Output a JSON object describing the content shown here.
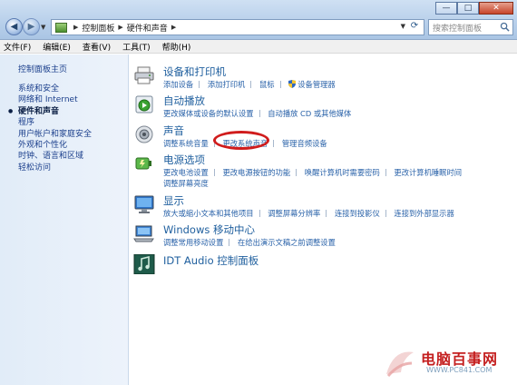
{
  "window": {
    "controls": {
      "minimize": "—",
      "maximize": "□",
      "close": "✕"
    }
  },
  "address": {
    "crumbs": [
      "控制面板",
      "硬件和声音"
    ]
  },
  "search": {
    "placeholder": "搜索控制面板"
  },
  "menu": [
    "文件(F)",
    "编辑(E)",
    "查看(V)",
    "工具(T)",
    "帮助(H)"
  ],
  "sidebar": {
    "home": "控制面板主页",
    "items": [
      {
        "label": "系统和安全",
        "active": false
      },
      {
        "label": "网络和 Internet",
        "active": false
      },
      {
        "label": "硬件和声音",
        "active": true
      },
      {
        "label": "程序",
        "active": false
      },
      {
        "label": "用户帐户和家庭安全",
        "active": false
      },
      {
        "label": "外观和个性化",
        "active": false
      },
      {
        "label": "时钟、语言和区域",
        "active": false
      },
      {
        "label": "轻松访问",
        "active": false
      }
    ]
  },
  "categories": [
    {
      "icon": "printer-icon",
      "title": "设备和打印机",
      "rows": [
        [
          "添加设备",
          "添加打印机",
          "鼠标",
          "设备管理器"
        ]
      ]
    },
    {
      "icon": "autoplay-icon",
      "title": "自动播放",
      "rows": [
        [
          "更改媒体或设备的默认设置",
          "自动播放 CD 或其他媒体"
        ]
      ]
    },
    {
      "icon": "speaker-icon",
      "title": "声音",
      "rows": [
        [
          "调整系统音量",
          "更改系统声音",
          "管理音频设备"
        ]
      ]
    },
    {
      "icon": "power-icon",
      "title": "电源选项",
      "rows": [
        [
          "更改电池设置",
          "更改电源按钮的功能",
          "唤醒计算机时需要密码",
          "更改计算机睡眠时间"
        ],
        [
          "调整屏幕亮度"
        ]
      ]
    },
    {
      "icon": "display-icon",
      "title": "显示",
      "rows": [
        [
          "放大或缩小文本和其他项目",
          "调整屏幕分辨率",
          "连接到投影仪",
          "连接到外部显示器"
        ]
      ]
    },
    {
      "icon": "mobility-center-icon",
      "title": "Windows 移动中心",
      "rows": [
        [
          "调整常用移动设置",
          "在给出演示文稿之前调整设置"
        ]
      ]
    },
    {
      "icon": "idt-audio-icon",
      "title": "IDT Audio 控制面板",
      "rows": []
    }
  ],
  "watermark": {
    "text": "电脑百事网",
    "url": "WWW.PC841.COM"
  },
  "colors": {
    "link": "#2861a8",
    "title": "#1f5f9e",
    "highlight": "#d01c1c",
    "sidebar_bg": "#e1ecf8"
  }
}
